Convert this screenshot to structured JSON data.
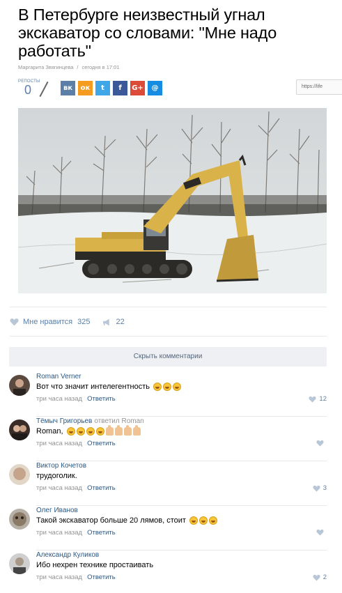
{
  "article": {
    "title": "В Петербурге неизвестный угнал экскаватор со словами: \"Мне надо работать\"",
    "author": "Маргарита Звягинцева",
    "meta_separator": "/",
    "date": "сегодня в 17:01"
  },
  "share": {
    "reposts_label": "РЕПОСТЫ",
    "reposts_count": "0",
    "url_text": "https://life",
    "buttons": [
      {
        "name": "vk",
        "glyph": "вк",
        "color": "#5b7fa6"
      },
      {
        "name": "odnoklassniki",
        "glyph": "ок",
        "color": "#f59b20"
      },
      {
        "name": "twitter",
        "glyph": "t",
        "color": "#3fa6e8"
      },
      {
        "name": "facebook",
        "glyph": "f",
        "color": "#3b5998"
      },
      {
        "name": "google-plus",
        "glyph": "G+",
        "color": "#dc4a38"
      },
      {
        "name": "mail",
        "glyph": "@",
        "color": "#168de2"
      }
    ]
  },
  "reactions": {
    "like_label": "Мне нравится",
    "like_count": "325",
    "share_count": "22"
  },
  "hide_comments_label": "Скрыть комментарии",
  "comments": [
    {
      "author": "Roman Verner",
      "replied": "",
      "text": "Вот что значит интелегентность",
      "emoji": [
        "laugh",
        "laugh",
        "laugh"
      ],
      "time": "три часа назад",
      "reply_label": "Ответить",
      "likes": "12"
    },
    {
      "author": "Тёмыч Григорьев",
      "replied": "ответил Roman",
      "text": "Roman,",
      "emoji": [
        "laugh",
        "laugh",
        "laugh",
        "laugh",
        "thumb",
        "thumb",
        "thumb",
        "thumb"
      ],
      "time": "три часа назад",
      "reply_label": "Ответить",
      "likes": ""
    },
    {
      "author": "Виктор Кочетов",
      "replied": "",
      "text": "трудоголик.",
      "emoji": [],
      "time": "три часа назад",
      "reply_label": "Ответить",
      "likes": "3"
    },
    {
      "author": "Олег Иванов",
      "replied": "",
      "text": "Такой экскаватор больше 20 лямов, стоит",
      "emoji": [
        "smile",
        "smile",
        "smile"
      ],
      "time": "три часа назад",
      "reply_label": "Ответить",
      "likes": ""
    },
    {
      "author": "Александр Куликов",
      "replied": "",
      "text": "Ибо нехрен технике простаивать",
      "emoji": [],
      "time": "три часа назад",
      "reply_label": "Ответить",
      "likes": "2"
    }
  ],
  "colors": {
    "link": "#2a5885",
    "accent": "#5b7fa6",
    "muted": "#939393",
    "excavator": "#d9b24a"
  }
}
